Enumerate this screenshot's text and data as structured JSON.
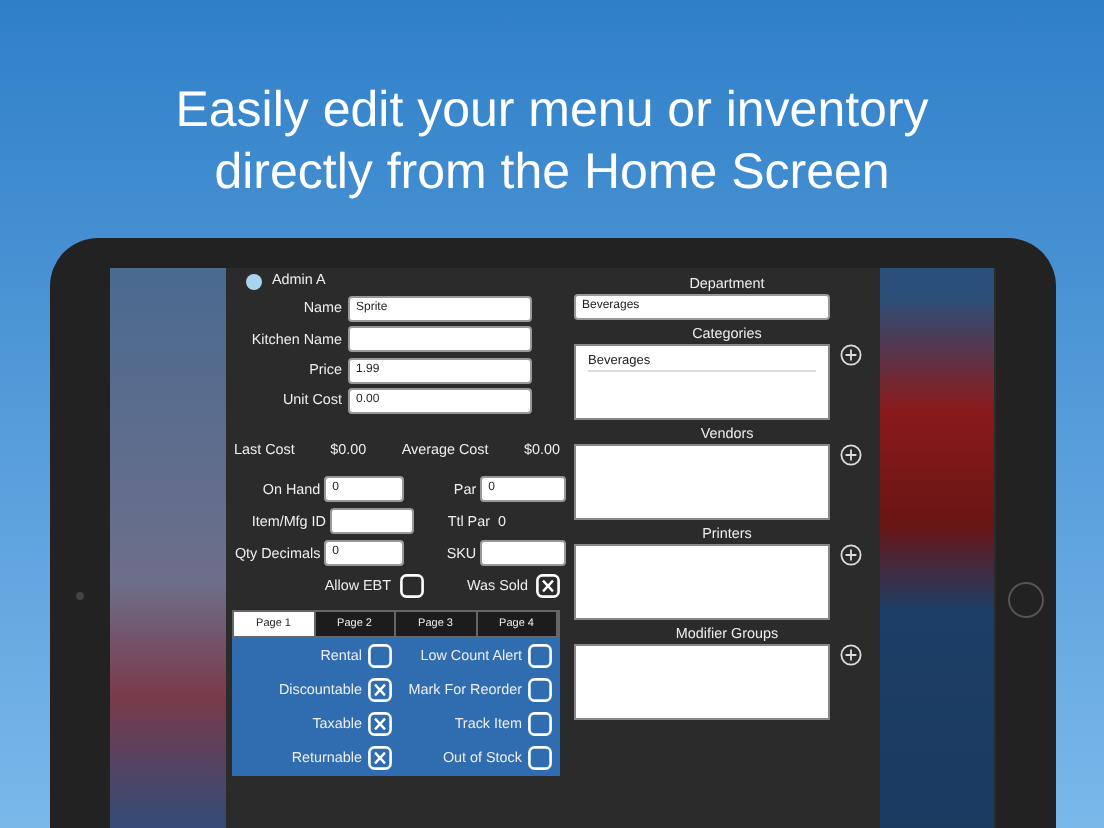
{
  "headline": "Easily edit your menu or inventory directly from the Home Screen",
  "user": {
    "name": "Admin A"
  },
  "fields": [
    {
      "label": "Name",
      "value": "Sprite"
    },
    {
      "label": "Kitchen Name"
    },
    {
      "label": "Price",
      "value": "1.99"
    },
    {
      "label": "Unit Cost",
      "value": "0.00"
    }
  ],
  "costs": [
    {
      "label": "Last Cost",
      "value": "$0.00"
    },
    {
      "label": "Average Cost",
      "value": "$0.00"
    }
  ],
  "pair_rows": [
    [
      {
        "kind": "input",
        "label": "On Hand",
        "value": "0"
      },
      {
        "kind": "input",
        "label": "Par",
        "value": "0"
      }
    ],
    [
      {
        "kind": "input",
        "label": "Item/Mfg ID"
      },
      {
        "kind": "text",
        "label": "Ttl Par",
        "value": "0"
      }
    ],
    [
      {
        "kind": "input",
        "label": "Qty Decimals",
        "value": "0"
      },
      {
        "kind": "input",
        "label": "SKU"
      }
    ]
  ],
  "flags": [
    {
      "label": "Allow EBT",
      "checked": false
    },
    {
      "label": "Was Sold",
      "checked": true
    }
  ],
  "tabs": [
    {
      "label": "Page 1",
      "selected": true
    },
    {
      "label": "Page 2",
      "selected": false
    },
    {
      "label": "Page 3",
      "selected": false
    },
    {
      "label": "Page 4",
      "selected": false
    }
  ],
  "options": [
    {
      "label": "Rental",
      "checked": false
    },
    {
      "label": "Low Count Alert",
      "checked": false
    },
    {
      "label": "Discountable",
      "checked": true
    },
    {
      "label": "Mark For Reorder",
      "checked": false
    },
    {
      "label": "Taxable",
      "checked": true
    },
    {
      "label": "Track Item",
      "checked": false
    },
    {
      "label": "Returnable",
      "checked": true
    },
    {
      "label": "Out of Stock",
      "checked": false
    }
  ],
  "department": {
    "label": "Department",
    "value": "Beverages"
  },
  "lists": [
    {
      "title": "Categories",
      "items": [
        "Beverages"
      ]
    },
    {
      "title": "Vendors"
    },
    {
      "title": "Printers"
    },
    {
      "title": "Modifier Groups"
    }
  ]
}
